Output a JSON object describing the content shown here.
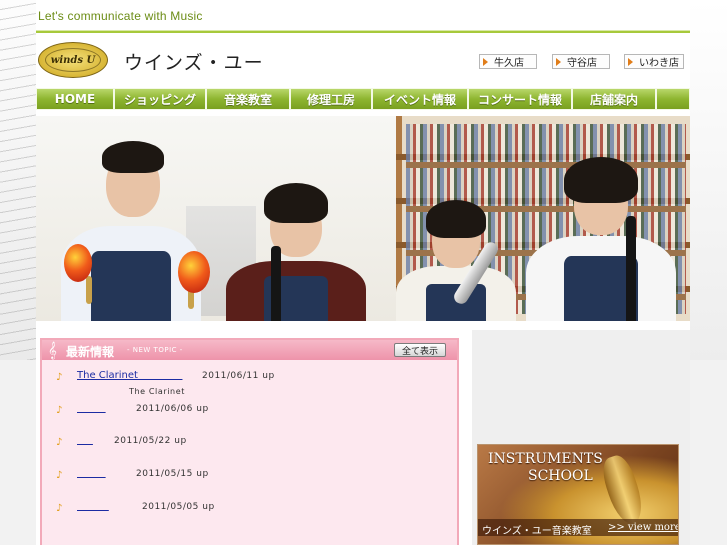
{
  "tagline": "Let's communicate with Music",
  "site_title": "ウインズ・ユー",
  "logo_text": "winds U",
  "store_links": [
    {
      "label": "牛久店"
    },
    {
      "label": "守谷店"
    },
    {
      "label": "いわき店"
    }
  ],
  "nav": [
    {
      "label": "HOME"
    },
    {
      "label": "ショッピング"
    },
    {
      "label": "音楽教室"
    },
    {
      "label": "修理工房"
    },
    {
      "label": "イベント情報"
    },
    {
      "label": "コンサート情報"
    },
    {
      "label": "店舗案内"
    }
  ],
  "news": {
    "icon": "treble-clef-icon",
    "title": "最新情報",
    "subtitle": "- NEW TOPIC -",
    "view_all": "全て表示",
    "items": [
      {
        "title": "The Clarinet              ",
        "date": "2011/06/11 up",
        "desc": "The Clarinet"
      },
      {
        "title": "         ",
        "date": "2011/06/06 up"
      },
      {
        "title": "     ",
        "date": "2011/05/22 up"
      },
      {
        "title": "         ",
        "date": "2011/05/15 up"
      },
      {
        "title": "          ",
        "date": "2011/05/05 up"
      }
    ]
  },
  "banner": {
    "title_line1": "INSTRUMENTS",
    "title_line2": "SCHOOL",
    "caption": "ウインズ・ユー音楽教室",
    "more": ">> view more"
  },
  "colors": {
    "accent_green": "#8fb331",
    "news_pink": "#f2a9b9",
    "link_blue": "#1c2ca3",
    "note_orange": "#e29d18"
  }
}
